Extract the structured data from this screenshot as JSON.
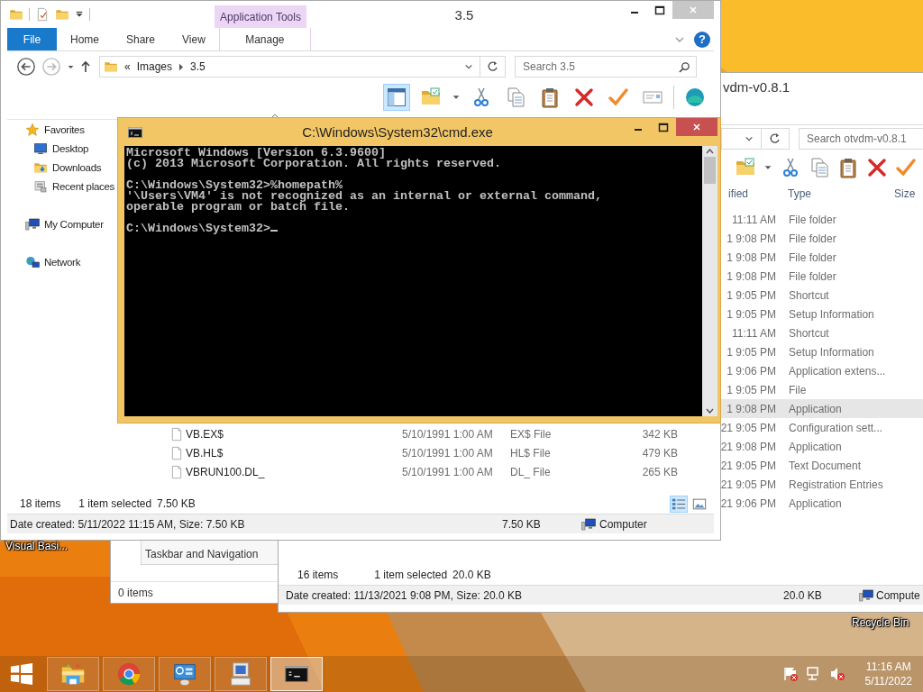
{
  "desktop": {
    "icons": [
      {
        "label": "Visual Basi..."
      },
      {
        "label": "Recycle Bin"
      }
    ]
  },
  "back_window": {
    "nav_item": "Taskbar and Navigation",
    "item_count": "0 items"
  },
  "otvdm_window": {
    "title": "vdm-v0.8.1",
    "search": {
      "placeholder": "Search otvdm-v0.8.1"
    },
    "columns": [
      "ified",
      "Type",
      "Size"
    ],
    "rows": [
      {
        "modified": "11:11 AM",
        "type": "File folder",
        "selected": false
      },
      {
        "modified": "1 9:08 PM",
        "type": "File folder",
        "selected": false
      },
      {
        "modified": "1 9:08 PM",
        "type": "File folder",
        "selected": false
      },
      {
        "modified": "1 9:08 PM",
        "type": "File folder",
        "selected": false
      },
      {
        "modified": "1 9:05 PM",
        "type": "Shortcut",
        "selected": false
      },
      {
        "modified": "1 9:05 PM",
        "type": "Setup Information",
        "selected": false
      },
      {
        "modified": "11:11 AM",
        "type": "Shortcut",
        "selected": false
      },
      {
        "modified": "1 9:05 PM",
        "type": "Setup Information",
        "selected": false
      },
      {
        "modified": "1 9:06 PM",
        "type": "Application extens...",
        "selected": false
      },
      {
        "modified": "1 9:05 PM",
        "type": "File",
        "selected": false
      },
      {
        "modified": "1 9:08 PM",
        "type": "Application",
        "selected": true
      },
      {
        "modified": "21 9:05 PM",
        "type": "Configuration sett...",
        "selected": false
      },
      {
        "modified": "21 9:08 PM",
        "type": "Application",
        "selected": false
      },
      {
        "modified": "21 9:05 PM",
        "type": "Text Document",
        "selected": false
      },
      {
        "modified": "21 9:05 PM",
        "type": "Registration Entries",
        "selected": false
      },
      {
        "modified": "21 9:06 PM",
        "type": "Application",
        "selected": false
      }
    ],
    "item_count": "16 items",
    "selection": "1 item selected",
    "selection_size": "20.0 KB",
    "details": "Date created: 11/13/2021 9:08 PM, Size: 20.0 KB",
    "size": "20.0 KB",
    "location": "Compute"
  },
  "explorer_window": {
    "context_tab": "Application Tools",
    "title": "3.5",
    "ribbon_tabs": [
      {
        "label": "File",
        "kind": "file"
      },
      {
        "label": "Home",
        "kind": "tab"
      },
      {
        "label": "Share",
        "kind": "tab"
      },
      {
        "label": "View",
        "kind": "tab"
      },
      {
        "label": "Manage",
        "kind": "context"
      }
    ],
    "help_button": "?",
    "address": {
      "overflow": "«",
      "crumbs": [
        "Images",
        "3.5"
      ]
    },
    "search": {
      "placeholder": "Search 3.5"
    },
    "toolbar": [
      {
        "kind": "pane",
        "selected": true
      },
      {
        "kind": "properties",
        "selected": false
      },
      {
        "kind": "cut",
        "selected": false
      },
      {
        "kind": "copy",
        "selected": false
      },
      {
        "kind": "paste",
        "selected": false
      },
      {
        "kind": "delete",
        "selected": false
      },
      {
        "kind": "check",
        "selected": false
      },
      {
        "kind": "card",
        "selected": false
      },
      {
        "kind": "globe",
        "selected": false
      }
    ],
    "nav": [
      {
        "label": "Favorites",
        "kind": "star",
        "children": [
          {
            "label": "Desktop",
            "kind": "desktop"
          },
          {
            "label": "Downloads",
            "kind": "downloads"
          },
          {
            "label": "Recent places",
            "kind": "recent"
          }
        ]
      },
      {
        "label": "My Computer",
        "kind": "computer"
      },
      {
        "label": "Network",
        "kind": "network"
      }
    ],
    "files": [
      {
        "name": "VB.EX$",
        "date": "5/10/1991 1:00 AM",
        "type": "EX$ File",
        "size": "342 KB"
      },
      {
        "name": "VB.HL$",
        "date": "5/10/1991 1:00 AM",
        "type": "HL$ File",
        "size": "479 KB"
      },
      {
        "name": "VBRUN100.DL_",
        "date": "5/10/1991 1:00 AM",
        "type": "DL_ File",
        "size": "265 KB"
      }
    ],
    "item_count": "18 items",
    "selection": "1 item selected",
    "selection_size": "7.50 KB",
    "views": [
      {
        "kind": "details",
        "selected": true
      },
      {
        "kind": "tiles",
        "selected": false
      }
    ],
    "details": "Date created: 5/11/2022 11:15 AM, Size: 7.50 KB",
    "size": "7.50 KB",
    "location": "Computer"
  },
  "cmd_window": {
    "title": "C:\\Windows\\System32\\cmd.exe",
    "console": [
      {
        "lines": [
          "Microsoft Windows [Version 6.3.9600]",
          "(c) 2013 Microsoft Corporation. All rights reserved."
        ]
      },
      {
        "lines": [
          "C:\\Windows\\System32>%homepath%",
          "'\\Users\\VM4' is not recognized as an internal or external command,",
          "operable program or batch file."
        ]
      },
      {
        "lines": [
          "C:\\Windows\\System32>"
        ]
      }
    ]
  },
  "taskbar": {
    "apps": [
      {
        "kind": "explorer",
        "selected": false
      },
      {
        "kind": "browser",
        "selected": false
      },
      {
        "kind": "control-panel",
        "selected": false
      },
      {
        "kind": "computer",
        "selected": false
      },
      {
        "kind": "console",
        "selected": true
      }
    ],
    "clock": {
      "time": "11:16 AM",
      "date": "5/11/2022"
    }
  }
}
